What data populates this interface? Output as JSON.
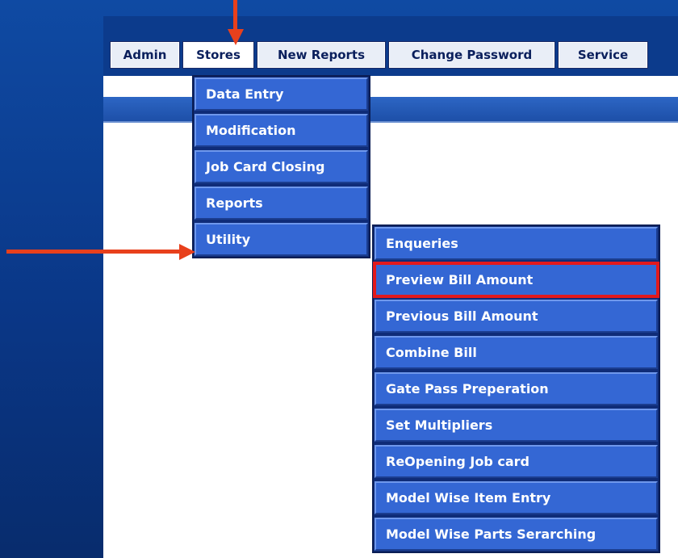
{
  "menubar": {
    "items": [
      "Admin",
      "Stores",
      "New Reports",
      "Change Password",
      "Service"
    ]
  },
  "stores_menu": {
    "items": [
      "Data Entry",
      "Modification",
      "Job Card Closing",
      "Reports",
      "Utility"
    ]
  },
  "utility_menu": {
    "items": [
      "Enqueries",
      "Preview Bill Amount",
      "Previous Bill Amount",
      "Combine Bill",
      "Gate Pass Preperation",
      "Set Multipliers",
      "ReOpening Job card",
      "Model Wise Item Entry",
      "Model Wise Parts Serarching"
    ]
  },
  "colors": {
    "annotation_arrow": "#e8401c",
    "highlight_box": "#e2191c",
    "menu_item_bg": "#3467d4"
  },
  "icons": {
    "annotation": "arrow-icon"
  }
}
